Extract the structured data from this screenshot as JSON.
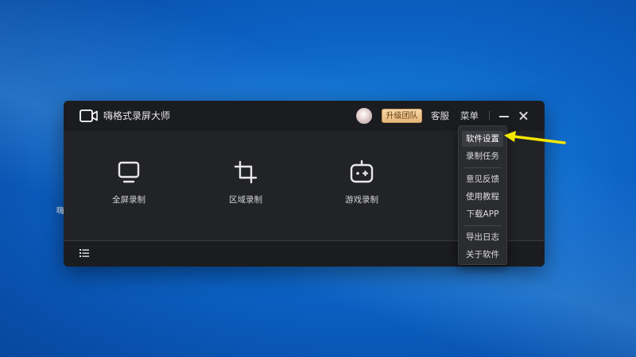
{
  "app": {
    "title": "嗨格式录屏大师",
    "upgrade_label": "升级团队",
    "service_label": "客服",
    "menu_label": "菜单"
  },
  "modes": [
    {
      "label": "全屏录制",
      "icon": "monitor-icon"
    },
    {
      "label": "区域录制",
      "icon": "crop-icon"
    },
    {
      "label": "游戏录制",
      "icon": "gamepad-icon"
    }
  ],
  "menu": {
    "items": [
      {
        "label": "软件设置",
        "active": true
      },
      {
        "label": "录制任务"
      },
      {
        "label": "意见反馈"
      },
      {
        "label": "使用教程"
      },
      {
        "label": "下载APP"
      },
      {
        "label": "导出日志"
      },
      {
        "label": "关于软件"
      }
    ]
  },
  "colors": {
    "window_bg": "#222327",
    "titlebar_bg": "#1b1c1f",
    "upgrade_bg": "#e6b87a",
    "annotation_arrow": "#f5e600",
    "desktop_blue": "#0c63c6"
  },
  "desktop": {
    "partial_icon_text": "嗨"
  }
}
